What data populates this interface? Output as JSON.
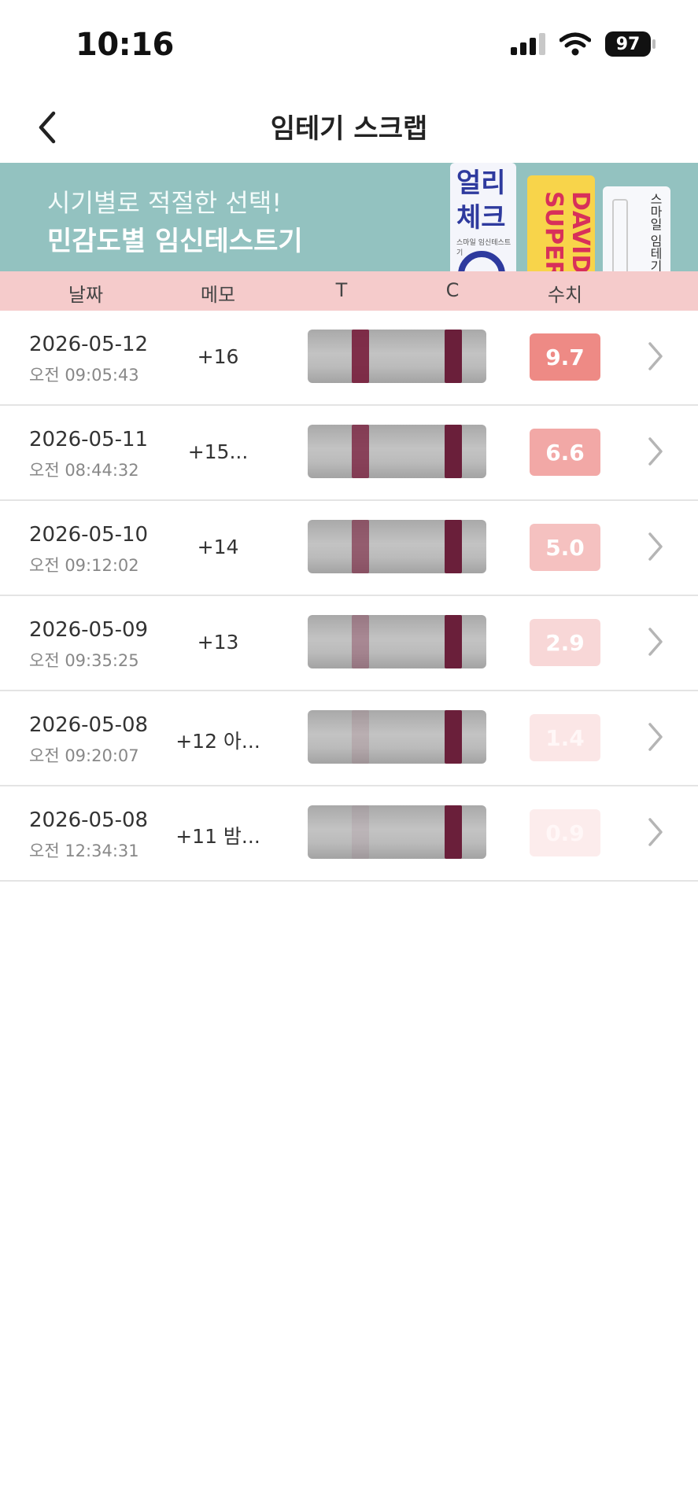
{
  "status_bar": {
    "time": "10:16",
    "battery": "97"
  },
  "header": {
    "title": "임테기 스크랩"
  },
  "banner": {
    "line1": "시기별로 적절한 선택!",
    "line2": "민감도별 임신테스트기",
    "product1_name": "얼리\n체크",
    "product1_sub": "스마일 임신테스트기",
    "product2_name": "DAVID-SUPER",
    "product3_name": "스마일 임테기",
    "colors": {
      "background": "#93c2c0",
      "product1": "#2e3a9e",
      "product2_bg": "#f8d44a",
      "product2_text": "#d8305a"
    }
  },
  "columns": {
    "date": "날짜",
    "memo": "메모",
    "t": "T",
    "c": "C",
    "value": "수치"
  },
  "rows": [
    {
      "date": "2026-05-12",
      "time": "오전 09:05:43",
      "memo": "+16",
      "value": "9.7",
      "t_line_intensity": 0.9,
      "badge_color": "#ee8a85"
    },
    {
      "date": "2026-05-11",
      "time": "오전 08:44:32",
      "memo": "+15...",
      "value": "6.6",
      "t_line_intensity": 0.78,
      "badge_color": "#f2a8a6"
    },
    {
      "date": "2026-05-10",
      "time": "오전 09:12:02",
      "memo": "+14",
      "value": "5.0",
      "t_line_intensity": 0.62,
      "badge_color": "#f5c1c0"
    },
    {
      "date": "2026-05-09",
      "time": "오전 09:35:25",
      "memo": "+13",
      "value": "2.9",
      "t_line_intensity": 0.35,
      "badge_color": "#f8d7d7"
    },
    {
      "date": "2026-05-08",
      "time": "오전 09:20:07",
      "memo": "+12 아...",
      "value": "1.4",
      "t_line_intensity": 0.12,
      "badge_color": "#fbe6e6"
    },
    {
      "date": "2026-05-08",
      "time": "오전 12:34:31",
      "memo": "+11 밤...",
      "value": "0.9",
      "t_line_intensity": 0.08,
      "badge_color": "#fcecec"
    }
  ]
}
